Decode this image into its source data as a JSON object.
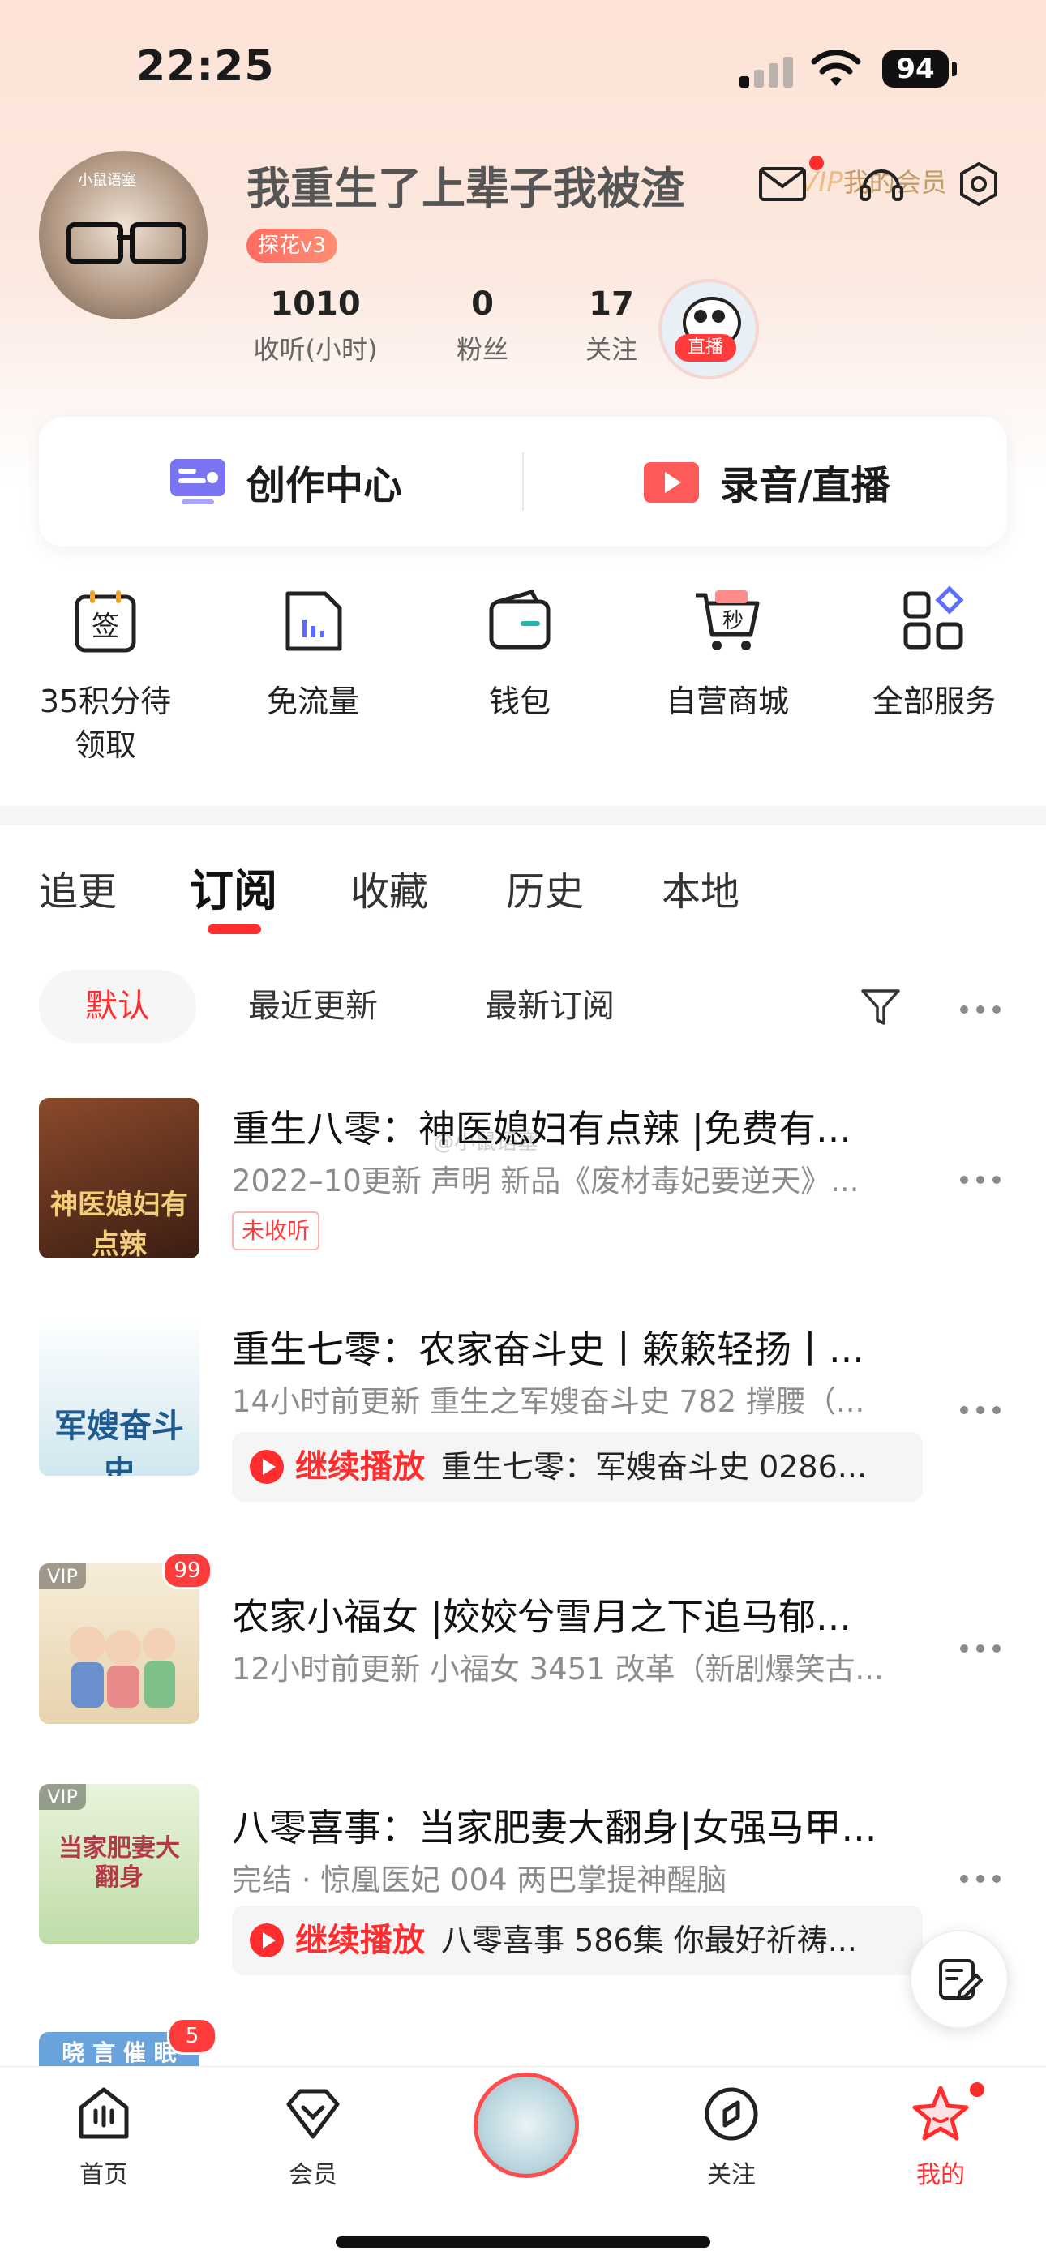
{
  "status_bar": {
    "time": "22:25",
    "battery": "94"
  },
  "profile": {
    "avatar_caption": "小鼠语塞",
    "username": "我重生了上辈子我被渣",
    "level_badge": "探花v3",
    "stats": [
      {
        "value": "1010",
        "label": "收听(小时)"
      },
      {
        "value": "0",
        "label": "粉丝"
      },
      {
        "value": "17",
        "label": "关注"
      }
    ],
    "live_label": "直播",
    "vip_text": "VIP",
    "vip_sub": "我的会员"
  },
  "create_card": {
    "left_label": "创作中心",
    "right_label": "录音/直播"
  },
  "services": [
    {
      "label": "35积分待\n领取",
      "icon": "sign-in-icon"
    },
    {
      "label": "免流量",
      "icon": "data-free-icon"
    },
    {
      "label": "钱包",
      "icon": "wallet-icon"
    },
    {
      "label": "自营商城",
      "icon": "shop-cart-icon"
    },
    {
      "label": "全部服务",
      "icon": "all-services-icon"
    }
  ],
  "tabs": [
    "追更",
    "订阅",
    "收藏",
    "历史",
    "本地"
  ],
  "active_tab": "订阅",
  "filters": [
    "默认",
    "最近更新",
    "最新订阅"
  ],
  "watermark": "@小鼠语塞",
  "list": [
    {
      "title": "重生八零：神医媳妇有点辣 |免费有...",
      "subtitle": "2022–10更新   声明 新品《废材毒妃要逆天》...",
      "tag": "未收听",
      "cover_text": "神医媳妇有点辣",
      "cover_color": "#3b1d12"
    },
    {
      "title": "重生七零：农家奋斗史丨簌簌轻扬丨...",
      "subtitle": "14小时前更新   重生之军嫂奋斗史 782 撑腰（...",
      "resume_label": "继续播放",
      "resume_text": "重生七零：军嫂奋斗史 0286...",
      "cover_text": "军嫂奋斗史",
      "cover_color": "#d8eef2"
    },
    {
      "title": "农家小福女 |姣姣兮雪月之下追马郁...",
      "subtitle": "12小时前更新   小福女 3451 改革（新剧爆笑古...",
      "badge": "99",
      "vip": "VIP",
      "cover_color": "#f1e5cf"
    },
    {
      "title": "八零喜事：当家肥妻大翻身|女强马甲...",
      "subtitle": "完结 · 惊凰医妃 004 两巴掌提神醒脑",
      "resume_label": "继续播放",
      "resume_text": "八零喜事 586集 你最好祈祷...",
      "vip": "VIP",
      "cover_text": "当家肥妻大翻身",
      "cover_color": "#dcecc7"
    },
    {
      "badge": "5",
      "cover_text": "晓 言 催 眠",
      "cover_color": "#6aa2dc"
    }
  ],
  "bottom_nav": [
    {
      "label": "首页",
      "icon": "home-icon"
    },
    {
      "label": "会员",
      "icon": "vip-diamond-icon"
    },
    {
      "label": "",
      "icon": "now-playing-disc"
    },
    {
      "label": "关注",
      "icon": "follow-icon"
    },
    {
      "label": "我的",
      "icon": "me-star-icon"
    }
  ],
  "colors": {
    "accent": "#ff2d2d",
    "hero_bg": "#fde3d6"
  }
}
